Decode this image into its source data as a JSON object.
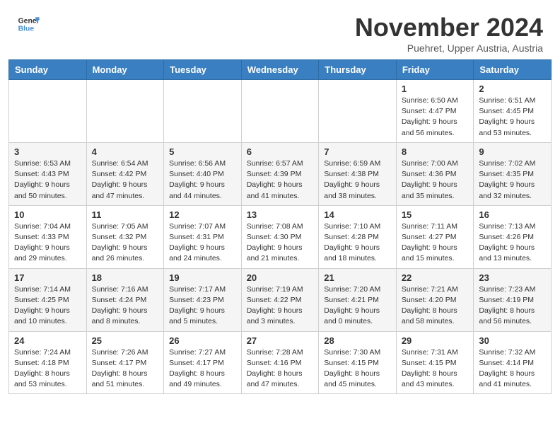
{
  "header": {
    "logo_line1": "General",
    "logo_line2": "Blue",
    "month_year": "November 2024",
    "location": "Puehret, Upper Austria, Austria"
  },
  "weekdays": [
    "Sunday",
    "Monday",
    "Tuesday",
    "Wednesday",
    "Thursday",
    "Friday",
    "Saturday"
  ],
  "weeks": [
    [
      {
        "day": "",
        "info": ""
      },
      {
        "day": "",
        "info": ""
      },
      {
        "day": "",
        "info": ""
      },
      {
        "day": "",
        "info": ""
      },
      {
        "day": "",
        "info": ""
      },
      {
        "day": "1",
        "info": "Sunrise: 6:50 AM\nSunset: 4:47 PM\nDaylight: 9 hours\nand 56 minutes."
      },
      {
        "day": "2",
        "info": "Sunrise: 6:51 AM\nSunset: 4:45 PM\nDaylight: 9 hours\nand 53 minutes."
      }
    ],
    [
      {
        "day": "3",
        "info": "Sunrise: 6:53 AM\nSunset: 4:43 PM\nDaylight: 9 hours\nand 50 minutes."
      },
      {
        "day": "4",
        "info": "Sunrise: 6:54 AM\nSunset: 4:42 PM\nDaylight: 9 hours\nand 47 minutes."
      },
      {
        "day": "5",
        "info": "Sunrise: 6:56 AM\nSunset: 4:40 PM\nDaylight: 9 hours\nand 44 minutes."
      },
      {
        "day": "6",
        "info": "Sunrise: 6:57 AM\nSunset: 4:39 PM\nDaylight: 9 hours\nand 41 minutes."
      },
      {
        "day": "7",
        "info": "Sunrise: 6:59 AM\nSunset: 4:38 PM\nDaylight: 9 hours\nand 38 minutes."
      },
      {
        "day": "8",
        "info": "Sunrise: 7:00 AM\nSunset: 4:36 PM\nDaylight: 9 hours\nand 35 minutes."
      },
      {
        "day": "9",
        "info": "Sunrise: 7:02 AM\nSunset: 4:35 PM\nDaylight: 9 hours\nand 32 minutes."
      }
    ],
    [
      {
        "day": "10",
        "info": "Sunrise: 7:04 AM\nSunset: 4:33 PM\nDaylight: 9 hours\nand 29 minutes."
      },
      {
        "day": "11",
        "info": "Sunrise: 7:05 AM\nSunset: 4:32 PM\nDaylight: 9 hours\nand 26 minutes."
      },
      {
        "day": "12",
        "info": "Sunrise: 7:07 AM\nSunset: 4:31 PM\nDaylight: 9 hours\nand 24 minutes."
      },
      {
        "day": "13",
        "info": "Sunrise: 7:08 AM\nSunset: 4:30 PM\nDaylight: 9 hours\nand 21 minutes."
      },
      {
        "day": "14",
        "info": "Sunrise: 7:10 AM\nSunset: 4:28 PM\nDaylight: 9 hours\nand 18 minutes."
      },
      {
        "day": "15",
        "info": "Sunrise: 7:11 AM\nSunset: 4:27 PM\nDaylight: 9 hours\nand 15 minutes."
      },
      {
        "day": "16",
        "info": "Sunrise: 7:13 AM\nSunset: 4:26 PM\nDaylight: 9 hours\nand 13 minutes."
      }
    ],
    [
      {
        "day": "17",
        "info": "Sunrise: 7:14 AM\nSunset: 4:25 PM\nDaylight: 9 hours\nand 10 minutes."
      },
      {
        "day": "18",
        "info": "Sunrise: 7:16 AM\nSunset: 4:24 PM\nDaylight: 9 hours\nand 8 minutes."
      },
      {
        "day": "19",
        "info": "Sunrise: 7:17 AM\nSunset: 4:23 PM\nDaylight: 9 hours\nand 5 minutes."
      },
      {
        "day": "20",
        "info": "Sunrise: 7:19 AM\nSunset: 4:22 PM\nDaylight: 9 hours\nand 3 minutes."
      },
      {
        "day": "21",
        "info": "Sunrise: 7:20 AM\nSunset: 4:21 PM\nDaylight: 9 hours\nand 0 minutes."
      },
      {
        "day": "22",
        "info": "Sunrise: 7:21 AM\nSunset: 4:20 PM\nDaylight: 8 hours\nand 58 minutes."
      },
      {
        "day": "23",
        "info": "Sunrise: 7:23 AM\nSunset: 4:19 PM\nDaylight: 8 hours\nand 56 minutes."
      }
    ],
    [
      {
        "day": "24",
        "info": "Sunrise: 7:24 AM\nSunset: 4:18 PM\nDaylight: 8 hours\nand 53 minutes."
      },
      {
        "day": "25",
        "info": "Sunrise: 7:26 AM\nSunset: 4:17 PM\nDaylight: 8 hours\nand 51 minutes."
      },
      {
        "day": "26",
        "info": "Sunrise: 7:27 AM\nSunset: 4:17 PM\nDaylight: 8 hours\nand 49 minutes."
      },
      {
        "day": "27",
        "info": "Sunrise: 7:28 AM\nSunset: 4:16 PM\nDaylight: 8 hours\nand 47 minutes."
      },
      {
        "day": "28",
        "info": "Sunrise: 7:30 AM\nSunset: 4:15 PM\nDaylight: 8 hours\nand 45 minutes."
      },
      {
        "day": "29",
        "info": "Sunrise: 7:31 AM\nSunset: 4:15 PM\nDaylight: 8 hours\nand 43 minutes."
      },
      {
        "day": "30",
        "info": "Sunrise: 7:32 AM\nSunset: 4:14 PM\nDaylight: 8 hours\nand 41 minutes."
      }
    ]
  ]
}
